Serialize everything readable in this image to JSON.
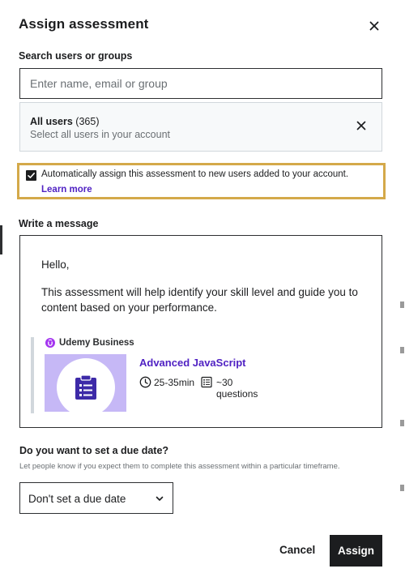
{
  "modal": {
    "title": "Assign assessment"
  },
  "search": {
    "label": "Search users or groups",
    "placeholder": "Enter name, email or group",
    "value": ""
  },
  "selected_group": {
    "name": "All users",
    "count": "(365)",
    "description": "Select all users in your account"
  },
  "auto_assign": {
    "checked": true,
    "text": "Automatically assign this assessment to new users added to your account.",
    "learn_more": "Learn more"
  },
  "message": {
    "label": "Write a message",
    "greeting": "Hello,",
    "body": "This assessment will help identify your skill level and guide you to content based on your performance.",
    "card": {
      "brand": "Udemy Business",
      "title": "Advanced JavaScript",
      "duration": "25-35min",
      "questions": "~30 questions"
    }
  },
  "due_date": {
    "label": "Do you want to set a due date?",
    "help": "Let people know if you expect them to complete this assessment within a particular timeframe.",
    "selected": "Don't set a due date"
  },
  "actions": {
    "cancel": "Cancel",
    "assign": "Assign"
  },
  "colors": {
    "accent_purple": "#5022c3",
    "highlight_border": "#d4a94a",
    "thumb_bg": "#c6b8f6",
    "primary_button": "#1c1d1f"
  },
  "icons": {
    "close": "close-icon",
    "remove_group": "close-icon",
    "checkbox": "checkmark-icon",
    "brand": "udemy-logo-icon",
    "assessment": "clipboard-icon",
    "duration": "clock-icon",
    "questions": "list-icon",
    "select": "chevron-down-icon"
  }
}
